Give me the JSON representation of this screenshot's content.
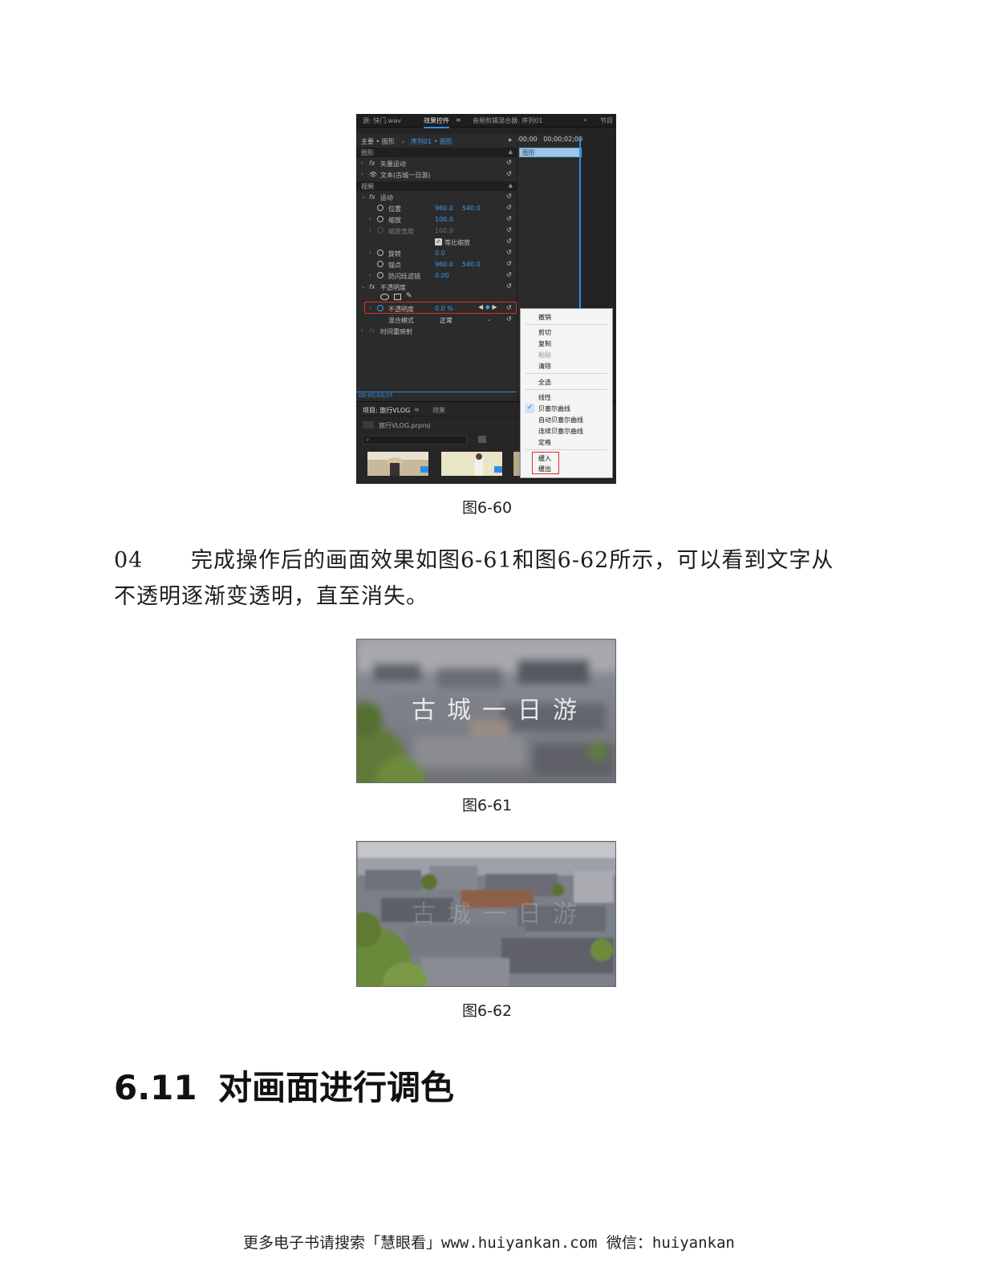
{
  "figure_60": {
    "tabs": [
      "源: 快门.wav",
      "效果控件",
      "≡",
      "音频剪辑混合器: 序列01",
      "»",
      "节目"
    ],
    "seq_bar": {
      "master": "主要 • 图形",
      "sequence": "序列01 • 图形",
      "time_start": ":00;00",
      "time_end": "00;00;02;00"
    },
    "timeline_clip": "图形",
    "groups": {
      "graphics": "图形",
      "video": "视频"
    },
    "rows": {
      "vector_motion": "矢量运动",
      "text": "文本(古城一日游)",
      "motion": "运动",
      "position": {
        "label": "位置",
        "v1": "960.0",
        "v2": "540.0"
      },
      "scale": {
        "label": "缩放",
        "v1": "100.0"
      },
      "scale_width": {
        "label": "缩放宽度",
        "v1": "100.0"
      },
      "uniform_scale": "等比缩放",
      "rotation": {
        "label": "旋转",
        "v1": "0.0"
      },
      "anchor": {
        "label": "锚点",
        "v1": "960.0",
        "v2": "540.0"
      },
      "anti_flicker": {
        "label": "防闪烁滤镜",
        "v1": "0.00"
      },
      "opacity_group": "不透明度",
      "opacity": {
        "label": "不透明度",
        "v1": "0.0 %"
      },
      "blend_mode": {
        "label": "混合模式",
        "value": "正常"
      },
      "time_remap": "时间重映射"
    },
    "current_time": "00;00;03;07",
    "project": {
      "tab": "项目: 旅行VLOG",
      "tab_menu": "≡",
      "effects_tab": "效果",
      "file": "旅行VLOG.prproj"
    },
    "context_menu": {
      "undo": "撤销",
      "cut": "剪切",
      "copy": "复制",
      "paste": "粘贴",
      "clear": "清除",
      "select_all": "全选",
      "linear": "线性",
      "bezier": "贝塞尔曲线",
      "auto_bezier": "自动贝塞尔曲线",
      "continuous_bezier": "连续贝塞尔曲线",
      "hold": "定格",
      "ease_in": "缓入",
      "ease_out": "缓出"
    },
    "caption": "图6-60"
  },
  "step": {
    "number": "04",
    "line1": "完成操作后的画面效果如图6-61和图6-62所示，可以看到文字从",
    "line2": "不透明逐渐变透明，直至消失。"
  },
  "figure_61": {
    "overlay_text": "古城一日游",
    "caption": "图6-61"
  },
  "figure_62": {
    "overlay_text": "古城一日游",
    "caption": "图6-62"
  },
  "section": {
    "number": "6.11",
    "title": "对画面进行调色"
  },
  "footer": "更多电子书请搜索「慧眼看」www.huiyankan.com  微信：huiyankan",
  "colors": {
    "accent_blue": "#2d8ceb",
    "highlight_red": "#d9312b",
    "panel_bg": "#2b2b2b"
  }
}
